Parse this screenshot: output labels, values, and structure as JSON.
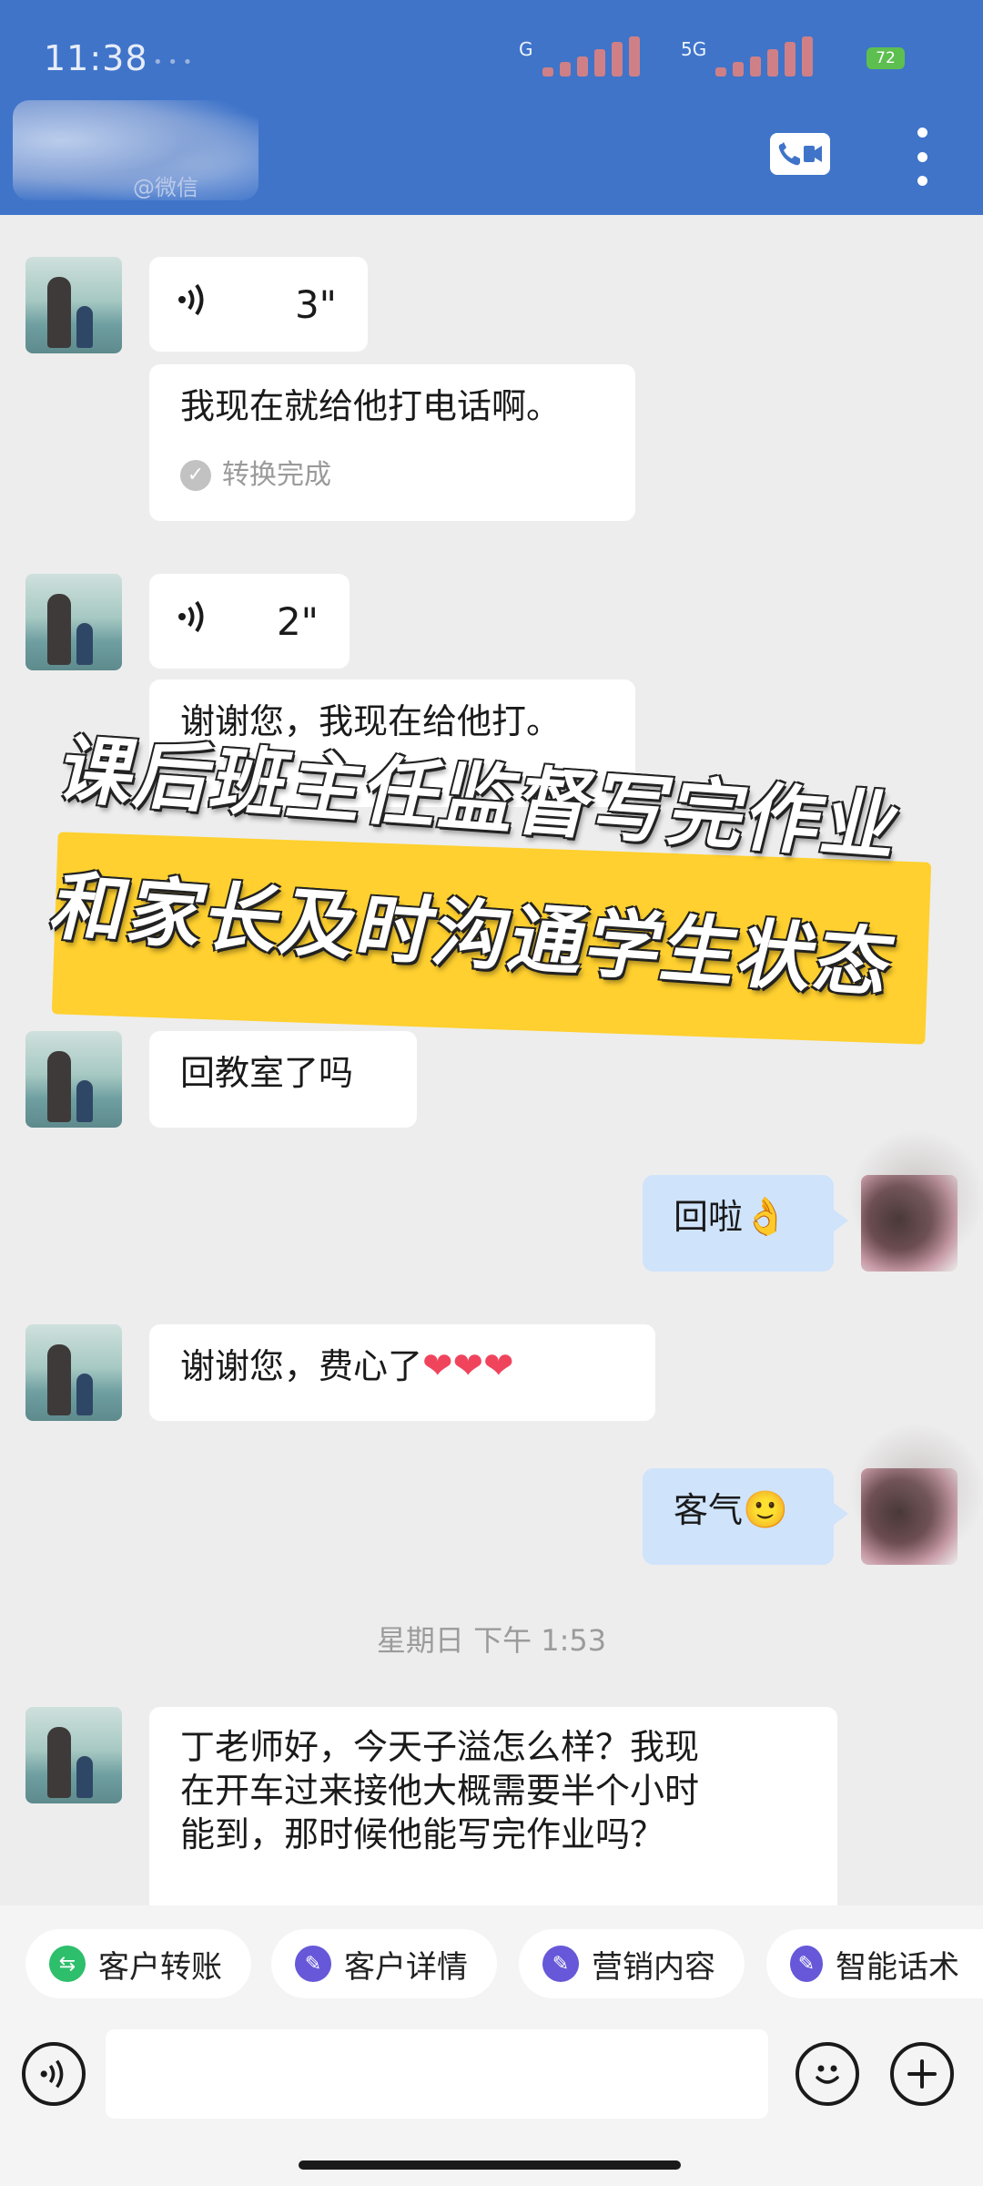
{
  "status_bar": {
    "time": "11:38",
    "dots": "• • •",
    "net1": "G",
    "net2": "5G",
    "battery": "72"
  },
  "header": {
    "contact_name": "",
    "sub_caption": "@微信",
    "call_icon": "video-call-icon",
    "more_icon": "more-vertical-icon"
  },
  "messages": [
    {
      "side": "left",
      "type": "voice",
      "duration": "3\""
    },
    {
      "side": "left",
      "type": "text",
      "text": "我现在就给他打电话啊。",
      "note": "转换完成"
    },
    {
      "side": "left",
      "type": "voice",
      "duration": "2\""
    },
    {
      "side": "left",
      "type": "text",
      "text": "谢谢您，我现在给他打。"
    },
    {
      "side": "left",
      "type": "text",
      "text": "回教室了吗"
    },
    {
      "side": "right",
      "type": "text",
      "text": "回啦",
      "emoji": "👌"
    },
    {
      "side": "left",
      "type": "text",
      "text": "谢谢您，费心了",
      "emoji": "❤❤❤"
    },
    {
      "side": "right",
      "type": "text",
      "text": "客气",
      "emoji": "🙂"
    },
    {
      "side": "left",
      "type": "text",
      "lines": [
        "丁老师好，今天子溢怎么样？我现",
        "在开车过来接他大概需要半个小时",
        "能到，那时候他能写完作业吗？"
      ]
    }
  ],
  "timestamp": "星期日  下午 1:53",
  "overlay": {
    "line1": "课后班主任监督写完作业",
    "line2": "和家长及时沟通学生状态"
  },
  "quick_actions": [
    {
      "label": "客户转账",
      "icon": "transfer-icon",
      "color": "#2dbf6b"
    },
    {
      "label": "客户详情",
      "icon": "customer-icon",
      "color": "#6658d8"
    },
    {
      "label": "营销内容",
      "icon": "marketing-icon",
      "color": "#6658d8"
    },
    {
      "label": "智能话术",
      "icon": "smart-script-icon",
      "color": "#6658d8"
    }
  ],
  "input": {
    "placeholder": "",
    "voice_icon": "voice-input-icon",
    "emoji_icon": "emoji-icon",
    "plus_icon": "plus-icon"
  },
  "colors": {
    "header_bg": "#3f74c9",
    "chat_bg": "#ededed",
    "my_bubble": "#cfe3fb",
    "highlight": "#ffd02f"
  }
}
